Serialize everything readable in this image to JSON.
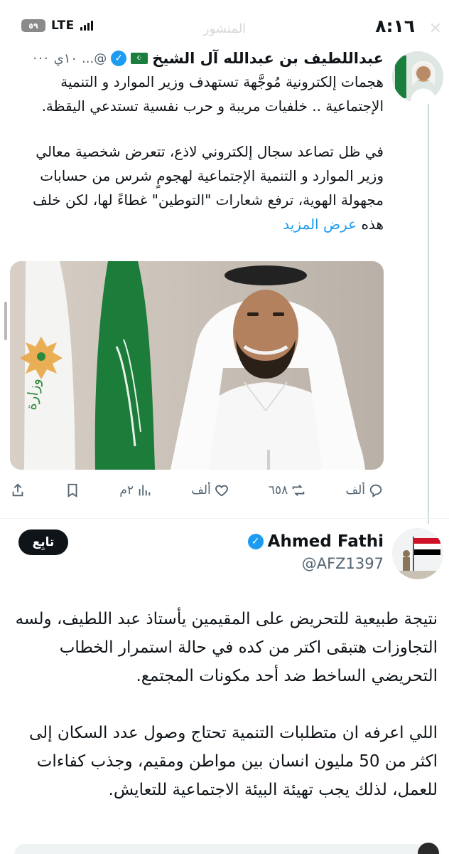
{
  "status_bar": {
    "time": "٨:١٦",
    "network": "LTE",
    "battery": "٥٩"
  },
  "ghost_title": "المنشور",
  "tweet": {
    "author_name": "عبداللطيف بن عبدالله آل الشيخ",
    "handle": "@...",
    "time": "١٠ي",
    "more": "···",
    "paragraphs": [
      "هجمات إلكترونية مُوجَّهة تستهدف وزير الموارد و التنمية الإجتماعية .. خلفيات مريبة و حرب نفسية تستدعي اليقظة.",
      "في ظل تصاعد سجال إلكتروني لاذع، تتعرض شخصية معالي وزير الموارد و التنمية الإجتماعية لهجومٍ شرس من حسابات مجهولة الهوية، ترفع شعارات \"التوطين\" غطاءً لها، لكن خلف هذه"
    ],
    "show_more": "عرض المزيد",
    "actions": {
      "replies": "ألف",
      "reposts": "٦٥٨",
      "likes": "ألف",
      "views": "٢م"
    }
  },
  "reply": {
    "author_name": "Ahmed Fathi",
    "handle": "@AFZ1397",
    "follow_label": "تابِع",
    "paragraphs": [
      "نتيجة طبيعية للتحريض على المقيمين يأستاذ عبد اللطيف، ولسه التجاوزات هتبقى اكتر من كده في حالة استمرار الخطاب التحريضي الساخط ضد أحد مكونات المجتمع.",
      "اللي اعرفه ان متطلبات التنمية تحتاج وصول عدد السكان إلى اكثر من 50 مليون انسان بين مواطن ومقيم، وجذب كفاءات للعمل، لذلك يجب تهيئة البيئة الاجتماعية للتعايش."
    ]
  },
  "colors": {
    "accent": "#1d9bf0",
    "muted": "#536471",
    "text": "#0f1419",
    "saudi_green": "#1a7f3c"
  }
}
